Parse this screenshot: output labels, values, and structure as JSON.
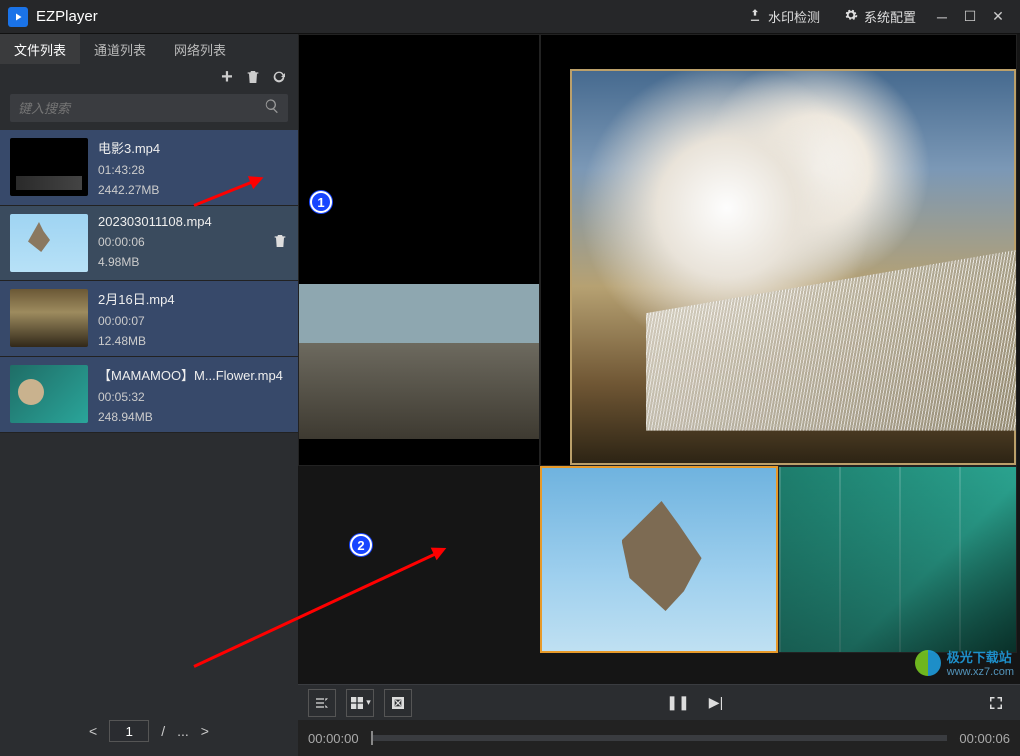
{
  "app": {
    "title": "EZPlayer"
  },
  "titlebar": {
    "watermark_btn": "水印检测",
    "settings_btn": "系统配置"
  },
  "side_tabs": {
    "items": [
      "文件列表",
      "通道列表",
      "网络列表"
    ],
    "active_index": 0
  },
  "search": {
    "placeholder": "键入搜索"
  },
  "files": [
    {
      "name": "电影3.mp4",
      "duration": "01:43:28",
      "size": "2442.27MB",
      "thumb": "t1",
      "state": "sel"
    },
    {
      "name": "202303011108.mp4",
      "duration": "00:00:06",
      "size": "4.98MB",
      "thumb": "t2",
      "state": "hov",
      "show_delete": true
    },
    {
      "name": "2月16日.mp4",
      "duration": "00:00:07",
      "size": "12.48MB",
      "thumb": "t3",
      "state": "sel"
    },
    {
      "name": "【MAMAMOO】M...Flower.mp4",
      "duration": "00:05:32",
      "size": "248.94MB",
      "thumb": "t4",
      "state": "sel"
    }
  ],
  "pager": {
    "page": "1",
    "sep": "/",
    "total": "..."
  },
  "annotations": {
    "n1": "1",
    "n2": "2"
  },
  "controls": {
    "pause_icon": "❚❚",
    "next_icon": "▶|"
  },
  "timeline": {
    "start": "00:00:00",
    "end": "00:00:06"
  },
  "watermark": {
    "main": "极光下载站",
    "sub": "www.xz7.com"
  }
}
